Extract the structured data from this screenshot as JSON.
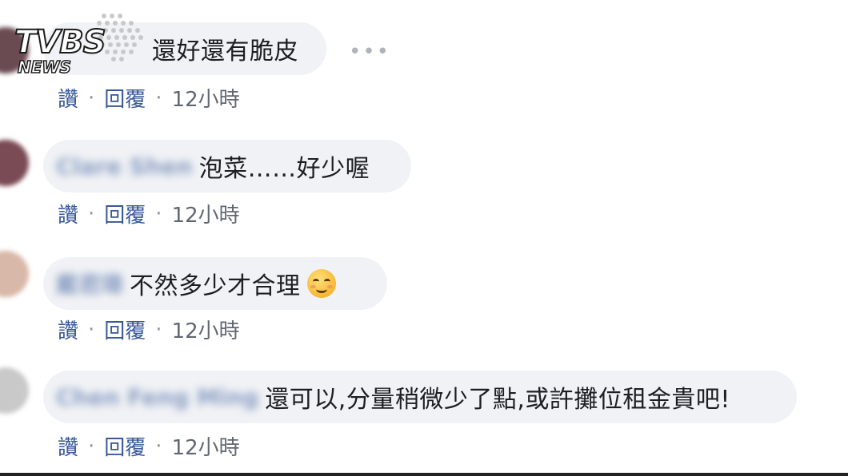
{
  "watermark": {
    "brand": "TVBS",
    "sub": "NEWS"
  },
  "more_icon": "ellipsis-icon",
  "comments": [
    {
      "author": "",
      "text": "還好還有脆皮",
      "actions": {
        "like": "讚",
        "reply": "回覆",
        "time": "12小時"
      },
      "avatar_color": "#6b4b52"
    },
    {
      "author": "Clare Shen",
      "text": "泡菜……好少喔",
      "actions": {
        "like": "讚",
        "reply": "回覆",
        "time": "12小時"
      },
      "avatar_color": "#7a4a55"
    },
    {
      "author": "戴君瑋",
      "text": "不然多少才合理",
      "emoji": "smiling-face-emoji",
      "actions": {
        "like": "讚",
        "reply": "回覆",
        "time": "12小時"
      },
      "avatar_color": "#d8b8a8"
    },
    {
      "author": "Chen Feng Ming",
      "text": "還可以,分量稍微少了點,或許攤位租金貴吧!",
      "actions": {
        "like": "讚",
        "reply": "回覆",
        "time": "12小時"
      },
      "avatar_color": "#c9c9c9"
    }
  ],
  "colors": {
    "bubble": "#f0f2f5",
    "link": "#385898",
    "author": "#365899",
    "text": "#1c1e21"
  }
}
